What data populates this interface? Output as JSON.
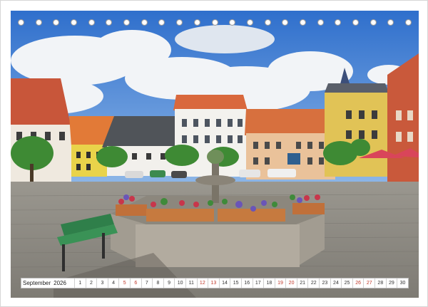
{
  "calendar": {
    "month": "September",
    "year": "2026",
    "days": [
      {
        "n": "1",
        "weekend": false
      },
      {
        "n": "2",
        "weekend": false
      },
      {
        "n": "3",
        "weekend": false
      },
      {
        "n": "4",
        "weekend": false
      },
      {
        "n": "5",
        "weekend": true
      },
      {
        "n": "6",
        "weekend": true
      },
      {
        "n": "7",
        "weekend": false
      },
      {
        "n": "8",
        "weekend": false
      },
      {
        "n": "9",
        "weekend": false
      },
      {
        "n": "10",
        "weekend": false
      },
      {
        "n": "11",
        "weekend": false
      },
      {
        "n": "12",
        "weekend": true
      },
      {
        "n": "13",
        "weekend": true
      },
      {
        "n": "14",
        "weekend": false
      },
      {
        "n": "15",
        "weekend": false
      },
      {
        "n": "16",
        "weekend": false
      },
      {
        "n": "17",
        "weekend": false
      },
      {
        "n": "18",
        "weekend": false
      },
      {
        "n": "19",
        "weekend": true
      },
      {
        "n": "20",
        "weekend": true
      },
      {
        "n": "21",
        "weekend": false
      },
      {
        "n": "22",
        "weekend": false
      },
      {
        "n": "23",
        "weekend": false
      },
      {
        "n": "24",
        "weekend": false
      },
      {
        "n": "25",
        "weekend": false
      },
      {
        "n": "26",
        "weekend": true
      },
      {
        "n": "27",
        "weekend": true
      },
      {
        "n": "28",
        "weekend": false
      },
      {
        "n": "29",
        "weekend": false
      },
      {
        "n": "30",
        "weekend": false
      }
    ]
  },
  "binding": {
    "ring_count": 23
  },
  "photo": {
    "scene": "town-square-fountain-icon"
  },
  "colors": {
    "weekend": "#c0392b",
    "sky": "#3f7fd0"
  }
}
